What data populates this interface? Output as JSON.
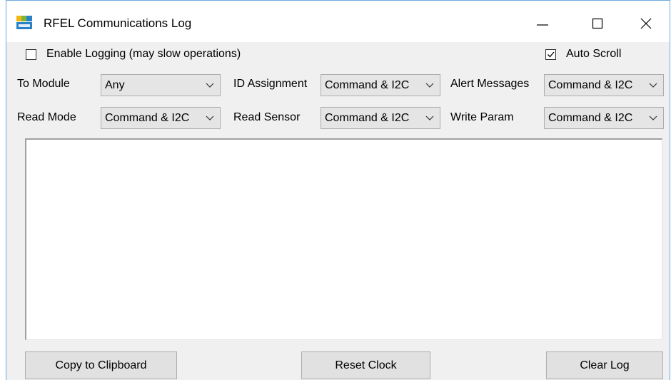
{
  "window": {
    "title": "RFEL Communications Log",
    "icon": "nxp-rfel-app-icon",
    "controls": [
      "minimize-icon",
      "maximize-icon",
      "close-icon"
    ]
  },
  "options": {
    "enable_logging": {
      "label": "Enable Logging (may slow operations)",
      "checked": false
    },
    "auto_scroll": {
      "label": "Auto Scroll",
      "checked": true
    }
  },
  "filters": {
    "to_module": {
      "label": "To Module",
      "value": "Any"
    },
    "id_assignment": {
      "label": "ID Assignment",
      "value": "Command & I2C"
    },
    "alert_messages": {
      "label": "Alert Messages",
      "value": "Command & I2C"
    },
    "read_mode": {
      "label": "Read Mode",
      "value": "Command & I2C"
    },
    "read_sensor": {
      "label": "Read Sensor",
      "value": "Command & I2C"
    },
    "write_param": {
      "label": "Write Param",
      "value": "Command & I2C"
    }
  },
  "log": {
    "text": ""
  },
  "buttons": {
    "copy": "Copy to Clipboard",
    "reset_clock": "Reset Clock",
    "clear_log": "Clear Log"
  },
  "colors": {
    "window_bg": "#f0f0f0",
    "titlebar_bg": "#ffffff",
    "accent_border": "#6fa8dc",
    "button_bg": "#e1e1e1"
  }
}
